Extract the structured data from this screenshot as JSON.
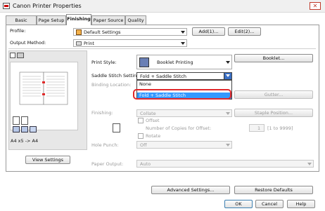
{
  "window": {
    "title": "Canon Printer Properties",
    "close_glyph": "✕"
  },
  "tabs": [
    {
      "label": "Basic Settings"
    },
    {
      "label": "Page Setup"
    },
    {
      "label": "Finishing"
    },
    {
      "label": "Paper Source"
    },
    {
      "label": "Quality"
    }
  ],
  "profile": {
    "label": "Profile:",
    "value": "Default Settings",
    "add_label": "Add(1)...",
    "edit_label": "Edit(2)..."
  },
  "output_method": {
    "label": "Output Method:",
    "value": "Print"
  },
  "preview": {
    "caption": "A4 x5 -> A4"
  },
  "view_settings_label": "View Settings",
  "print_style": {
    "label": "Print Style:",
    "value": "Booklet Printing",
    "booklet_button": "Booklet..."
  },
  "saddle_stitch": {
    "label": "Saddle Stitch Setting:",
    "value": "Fold + Saddle Stitch",
    "options": [
      "None",
      "Fold + Saddle Stitch"
    ]
  },
  "binding_location": {
    "label": "Binding Location:"
  },
  "gutter_label": "Gutter...",
  "finishing": {
    "label": "Finishing:",
    "value": "Collate",
    "staple_button": "Staple Position..."
  },
  "offset": {
    "label": "Offset",
    "copies_label": "Number of Copies for Offset:",
    "copies_value": "1",
    "copies_range": "[1 to 9999]"
  },
  "rotate": {
    "label": "Rotate"
  },
  "hole_punch": {
    "label": "Hole Punch:",
    "value": "Off"
  },
  "paper_output": {
    "label": "Paper Output:",
    "value": "Auto"
  },
  "advanced_settings_label": "Advanced Settings...",
  "restore_defaults_label": "Restore Defaults",
  "footer": {
    "ok": "OK",
    "cancel": "Cancel",
    "help": "Help"
  },
  "colors": {
    "selection": "#3399ff",
    "highlight": "#e0282b",
    "accent": "#3a6fc4"
  }
}
